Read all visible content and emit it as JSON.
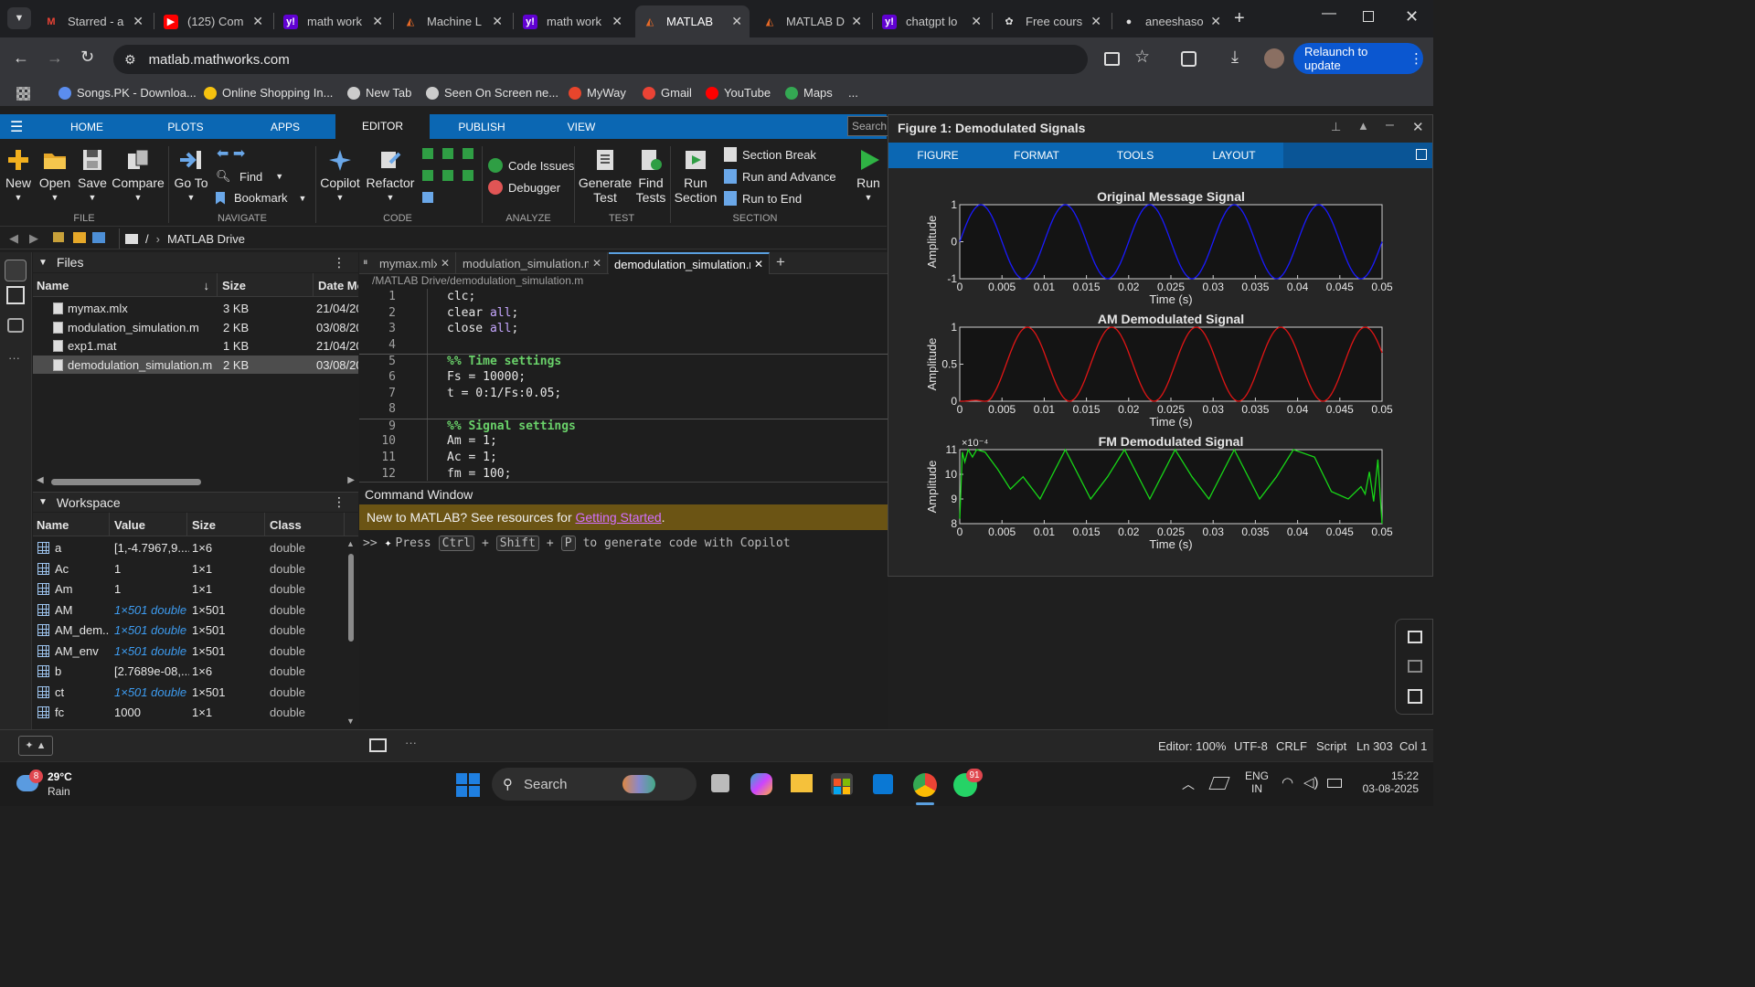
{
  "browser": {
    "tabs": [
      {
        "label": "Starred - a",
        "icon": "gmail-icon",
        "active": false
      },
      {
        "label": "(125) Com",
        "icon": "youtube-icon",
        "active": false
      },
      {
        "label": "math work",
        "icon": "yahoo-icon",
        "active": false
      },
      {
        "label": "Machine L",
        "icon": "matlab-icon",
        "active": false
      },
      {
        "label": "math work",
        "icon": "yahoo-icon",
        "active": false
      },
      {
        "label": "MATLAB",
        "icon": "matlab-icon",
        "active": true
      },
      {
        "label": "MATLAB D",
        "icon": "matlab-icon",
        "active": false
      },
      {
        "label": "chatgpt lo",
        "icon": "yahoo-icon",
        "active": false
      },
      {
        "label": "Free cours",
        "icon": "openai-icon",
        "active": false
      },
      {
        "label": "aneeshaso",
        "icon": "github-icon",
        "active": false
      }
    ],
    "url": "matlab.mathworks.com",
    "relaunch_label": "Relaunch to update",
    "bookmarks": [
      "Songs.PK - Downloa...",
      "Online Shopping In...",
      "New Tab",
      "Seen On Screen ne...",
      "MyWay",
      "Gmail",
      "YouTube",
      "Maps",
      "..."
    ]
  },
  "matlab": {
    "nav_tabs": [
      "HOME",
      "PLOTS",
      "APPS",
      "EDITOR",
      "PUBLISH",
      "VIEW"
    ],
    "active_nav": "EDITOR",
    "search_placeholder": "Search",
    "ribbon": {
      "new": "New",
      "open": "Open",
      "save": "Save",
      "compare": "Compare",
      "goto": "Go To",
      "find": "Find",
      "bookmark": "Bookmark",
      "copilot": "Copilot",
      "refactor": "Refactor",
      "code_issues": "Code Issues",
      "debugger": "Debugger",
      "generate_test": "Generate Test",
      "find_tests": "Find Tests",
      "run_section": "Run Section",
      "section_break": "Section Break",
      "run_and_advance": "Run and Advance",
      "run_to_end": "Run to End",
      "run": "Run",
      "groups": [
        "FILE",
        "NAVIGATE",
        "CODE",
        "ANALYZE",
        "TEST",
        "SECTION"
      ]
    },
    "path": {
      "root": "/",
      "folder": "MATLAB Drive"
    },
    "files": {
      "title": "Files",
      "columns": [
        "Name",
        "Size",
        "Date Mo"
      ],
      "rows": [
        {
          "name": "mymax.mlx",
          "size": "3 KB",
          "date": "21/04/20"
        },
        {
          "name": "modulation_simulation.m",
          "size": "2 KB",
          "date": "03/08/20"
        },
        {
          "name": "exp1.mat",
          "size": "1 KB",
          "date": "21/04/20"
        },
        {
          "name": "demodulation_simulation.m",
          "size": "2 KB",
          "date": "03/08/20"
        }
      ]
    },
    "workspace": {
      "title": "Workspace",
      "columns": [
        "Name",
        "Value",
        "Size",
        "Class"
      ],
      "rows": [
        {
          "name": "a",
          "value": "[1,-4.7967,9....",
          "size": "1×6",
          "class": "double",
          "link": false
        },
        {
          "name": "Ac",
          "value": "1",
          "size": "1×1",
          "class": "double",
          "link": false
        },
        {
          "name": "Am",
          "value": "1",
          "size": "1×1",
          "class": "double",
          "link": false
        },
        {
          "name": "AM",
          "value": "1×501 double",
          "size": "1×501",
          "class": "double",
          "link": true
        },
        {
          "name": "AM_dem...",
          "value": "1×501 double",
          "size": "1×501",
          "class": "double",
          "link": true
        },
        {
          "name": "AM_env",
          "value": "1×501 double",
          "size": "1×501",
          "class": "double",
          "link": true
        },
        {
          "name": "b",
          "value": "[2.7689e-08,...",
          "size": "1×6",
          "class": "double",
          "link": false
        },
        {
          "name": "ct",
          "value": "1×501 double",
          "size": "1×501",
          "class": "double",
          "link": true
        },
        {
          "name": "fc",
          "value": "1000",
          "size": "1×1",
          "class": "double",
          "link": false
        }
      ]
    },
    "editor": {
      "tabs": [
        "mymax.mlx",
        "modulation_simulation.m",
        "demodulation_simulation.m"
      ],
      "active_tab": "demodulation_simulation.m",
      "path": "/MATLAB Drive/demodulation_simulation.m",
      "lines": [
        {
          "n": "1",
          "code": "clc;"
        },
        {
          "n": "2",
          "code": "clear all;"
        },
        {
          "n": "3",
          "code": "close all;"
        },
        {
          "n": "4",
          "code": ""
        },
        {
          "n": "5",
          "code": "%% Time settings"
        },
        {
          "n": "6",
          "code": "Fs = 10000;"
        },
        {
          "n": "7",
          "code": "t = 0:1/Fs:0.05;"
        },
        {
          "n": "8",
          "code": ""
        },
        {
          "n": "9",
          "code": "%% Signal settings"
        },
        {
          "n": "10",
          "code": "Am = 1;"
        },
        {
          "n": "11",
          "code": "Ac = 1;"
        },
        {
          "n": "12",
          "code": "fm = 100;"
        }
      ]
    },
    "command_window": {
      "title": "Command Window",
      "banner_text": "New to MATLAB? See resources for ",
      "banner_link": "Getting Started",
      "banner_end": ".",
      "prompt": ">>",
      "hint_pre": "Press",
      "key1": "Ctrl",
      "plus1": "+",
      "key2": "Shift",
      "plus2": "+",
      "key3": "P",
      "hint_post": "to generate code with Copilot"
    },
    "status": {
      "zoom": "Editor: 100%",
      "encoding": "UTF-8",
      "eol": "CRLF",
      "type": "Script",
      "position": "Ln 303  Col 1"
    }
  },
  "figure": {
    "title": "Figure 1: Demodulated Signals",
    "tabs": [
      "FIGURE",
      "FORMAT",
      "TOOLS",
      "LAYOUT"
    ]
  },
  "chart_data": [
    {
      "type": "line",
      "title": "Original Message Signal",
      "xlabel": "Time (s)",
      "ylabel": "Amplitude",
      "xlim": [
        0,
        0.05
      ],
      "ylim": [
        -1,
        1
      ],
      "xticks": [
        "0",
        "0.005",
        "0.01",
        "0.015",
        "0.02",
        "0.025",
        "0.03",
        "0.035",
        "0.04",
        "0.045",
        "0.05"
      ],
      "yticks": [
        "-1",
        "0",
        "1"
      ],
      "color": "#1a1aff",
      "series": [
        {
          "x": [
            0,
            0.0025,
            0.005,
            0.0075,
            0.01,
            0.0125,
            0.015,
            0.0175,
            0.02,
            0.0225,
            0.025,
            0.0275,
            0.03,
            0.0325,
            0.035,
            0.0375,
            0.04,
            0.0425,
            0.045,
            0.0475,
            0.05
          ],
          "y": [
            0,
            1,
            0,
            -1,
            0,
            1,
            0,
            -1,
            0,
            1,
            0,
            -1,
            0,
            1,
            0,
            -1,
            0,
            1,
            0,
            -1,
            0
          ]
        }
      ]
    },
    {
      "type": "line",
      "title": "AM Demodulated Signal",
      "xlabel": "Time (s)",
      "ylabel": "Amplitude",
      "xlim": [
        0,
        0.05
      ],
      "ylim": [
        0,
        1
      ],
      "xticks": [
        "0",
        "0.005",
        "0.01",
        "0.015",
        "0.02",
        "0.025",
        "0.03",
        "0.035",
        "0.04",
        "0.045",
        "0.05"
      ],
      "yticks": [
        "0",
        "0.5",
        "1"
      ],
      "color": "#e01515",
      "series": [
        {
          "x": [
            0,
            0.001,
            0.002,
            0.003,
            0.005,
            0.008,
            0.0105,
            0.013,
            0.018,
            0.0205,
            0.023,
            0.028,
            0.0305,
            0.033,
            0.038,
            0.0405,
            0.043,
            0.048,
            0.05
          ],
          "y": [
            0,
            0.01,
            0.05,
            0.2,
            0.65,
            1,
            0.5,
            0,
            1,
            0.5,
            0,
            1,
            0.5,
            0,
            1,
            0.5,
            0,
            1,
            0.9
          ]
        }
      ]
    },
    {
      "type": "line",
      "title": "FM Demodulated Signal",
      "xlabel": "Time (s)",
      "ylabel": "Amplitude",
      "xlim": [
        0,
        0.05
      ],
      "ylim": [
        8,
        11
      ],
      "exponent_label": "×10⁻⁴",
      "xticks": [
        "0",
        "0.005",
        "0.01",
        "0.015",
        "0.02",
        "0.025",
        "0.03",
        "0.035",
        "0.04",
        "0.045",
        "0.05"
      ],
      "yticks": [
        "8",
        "9",
        "10",
        "11"
      ],
      "color": "#17d617",
      "series": [
        {
          "x": [
            0,
            0.0003,
            0.0006,
            0.001,
            0.0015,
            0.002,
            0.003,
            0.0045,
            0.006,
            0.0075,
            0.0095,
            0.0125,
            0.0155,
            0.0175,
            0.0195,
            0.0225,
            0.0255,
            0.0275,
            0.0295,
            0.0325,
            0.0355,
            0.0375,
            0.0395,
            0.042,
            0.044,
            0.046,
            0.0475,
            0.048,
            0.0485,
            0.049,
            0.0495,
            0.05
          ],
          "y": [
            8.2,
            10.9,
            10.5,
            11,
            10.7,
            11,
            10.9,
            10.2,
            9.4,
            9.9,
            9.0,
            11.0,
            9.0,
            9.9,
            11.0,
            9.0,
            11.0,
            9.9,
            9.0,
            11.0,
            9.0,
            9.9,
            11.0,
            10.7,
            9.3,
            9.0,
            9.5,
            9.2,
            10.1,
            8.9,
            10.6,
            8.0
          ]
        }
      ]
    }
  ],
  "taskbar": {
    "weather_temp": "29°C",
    "weather_desc": "Rain",
    "weather_badge": "8",
    "search_label": "Search",
    "whatsapp_badge": "91",
    "lang_top": "ENG",
    "lang_bottom": "IN",
    "time": "15:22",
    "date": "03-08-2025"
  }
}
